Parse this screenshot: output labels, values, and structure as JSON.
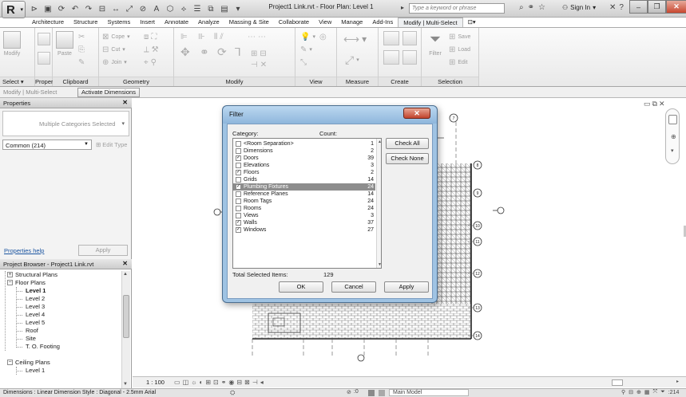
{
  "title_bar": {
    "document_title": "Project1 Link.rvt - Floor Plan: Level 1",
    "search_placeholder": "Type a keyword or phrase",
    "sign_in": "Sign In",
    "help": "?",
    "app_logo": "R"
  },
  "ribbon_tabs": [
    "Architecture",
    "Structure",
    "Systems",
    "Insert",
    "Annotate",
    "Analyze",
    "Massing & Site",
    "Collaborate",
    "View",
    "Manage",
    "Add-Ins",
    "Modify | Multi-Select"
  ],
  "ribbon_panels": {
    "select": "Select ▾",
    "properties": "Properties",
    "clipboard": "Clipboard",
    "geometry": "Geometry",
    "modify": "Modify",
    "view": "View",
    "measure": "Measure",
    "create": "Create",
    "selection": "Selection"
  },
  "ribbon_buttons": {
    "modify": "Modify",
    "paste": "Paste",
    "cope": "Cope",
    "cut": "Cut",
    "join": "Join",
    "filter": "Filter",
    "save": "Save",
    "load": "Load",
    "edit": "Edit"
  },
  "options_bar": {
    "label": "Modify | Multi-Select",
    "activate_dimensions": "Activate Dimensions"
  },
  "properties": {
    "header": "Properties",
    "type_selector": "Multiple Categories Selected",
    "instance_filter": "Common (214)",
    "edit_type": "Edit Type",
    "help_link": "Properties help",
    "apply": "Apply"
  },
  "browser": {
    "header": "Project Browser - Project1 Link.rvt",
    "nodes": [
      "Structural Plans",
      "Floor Plans",
      "Level 1",
      "Level 2",
      "Level 3",
      "Level 4",
      "Level 5",
      "Roof",
      "Site",
      "T. O. Footing",
      "Ceiling Plans",
      "Level 1"
    ]
  },
  "view_control": {
    "scale": "1 : 100"
  },
  "status_bar": {
    "text": "Dimensions : Linear Dimension Style : Diagonal - 2.5mm Arial",
    "workset_value": ":0",
    "model": "Main Model",
    "filter_count": ":214"
  },
  "filter_dialog": {
    "title": "Filter",
    "category_label": "Category:",
    "count_label": "Count:",
    "categories": [
      {
        "name": "<Room Separation>",
        "count": "1",
        "checked": false
      },
      {
        "name": "Dimensions",
        "count": "2",
        "checked": false
      },
      {
        "name": "Doors",
        "count": "39",
        "checked": true
      },
      {
        "name": "Elevations",
        "count": "3",
        "checked": false
      },
      {
        "name": "Floors",
        "count": "2",
        "checked": true
      },
      {
        "name": "Grids",
        "count": "14",
        "checked": false
      },
      {
        "name": "Plumbing Fixtures",
        "count": "24",
        "checked": true,
        "selected": true
      },
      {
        "name": "Reference Planes",
        "count": "14",
        "checked": false
      },
      {
        "name": "Room Tags",
        "count": "24",
        "checked": false
      },
      {
        "name": "Rooms",
        "count": "24",
        "checked": false
      },
      {
        "name": "Views",
        "count": "3",
        "checked": false
      },
      {
        "name": "Walls",
        "count": "37",
        "checked": true
      },
      {
        "name": "Windows",
        "count": "27",
        "checked": true
      }
    ],
    "check_all": "Check All",
    "check_none": "Check None",
    "total_label": "Total Selected Items:",
    "total_value": "129",
    "ok": "OK",
    "cancel": "Cancel",
    "apply": "Apply"
  },
  "drawing": {
    "grid_bubbles": [
      "7",
      "8",
      "9",
      "10",
      "11",
      "12",
      "13",
      "14"
    ],
    "accent_color": "#555555",
    "hatch_color": "#6a6a6a"
  },
  "colors": {
    "dialog_frame": "#9fc3e3",
    "selected_row": "#8d8d8d",
    "close_button": "#c1432c"
  }
}
